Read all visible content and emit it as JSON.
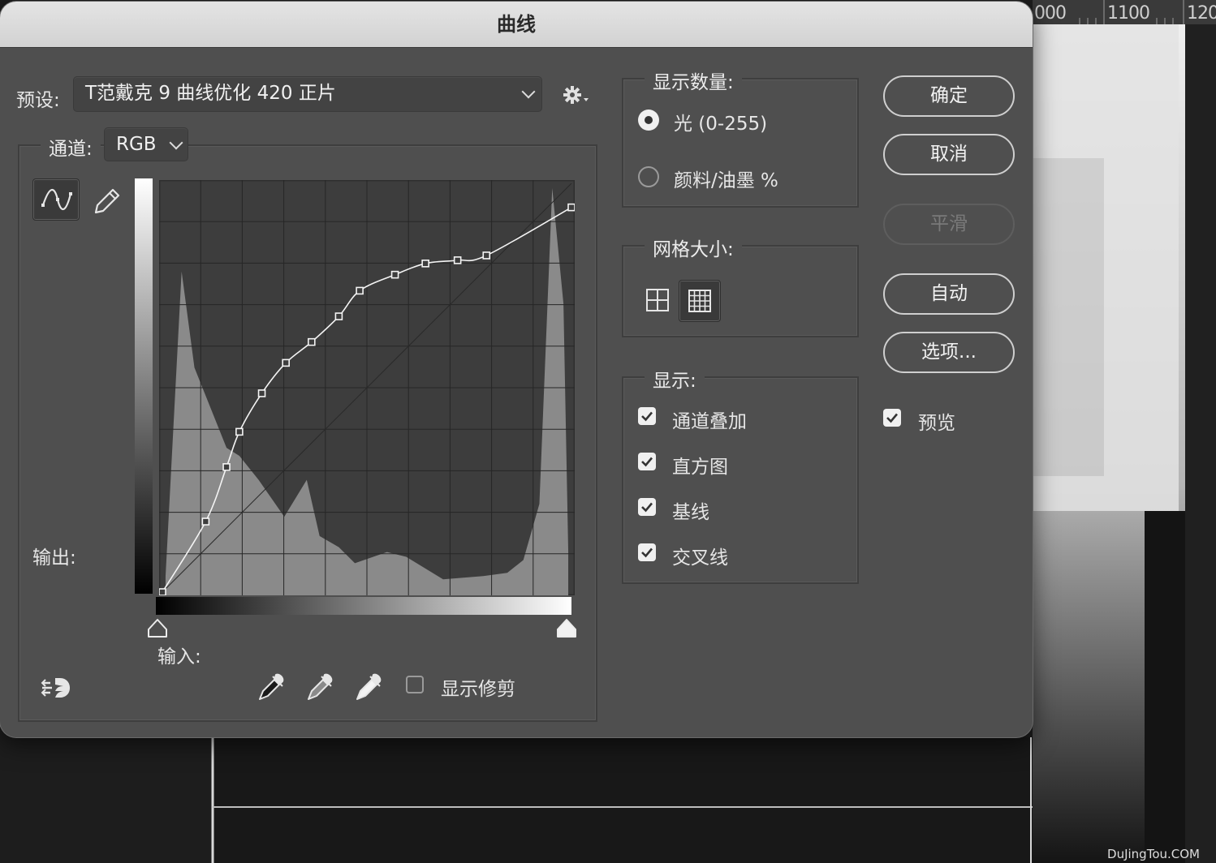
{
  "background": {
    "ruler_labels": [
      "000",
      "1100",
      "120"
    ],
    "watermark": "DuJingTou.COM"
  },
  "dialog": {
    "title": "曲线",
    "preset": {
      "label": "预设:",
      "value": "T范戴克 9 曲线优化 420 正片",
      "gear_icon": "gear-icon"
    },
    "channel": {
      "label": "通道:",
      "value": "RGB"
    },
    "tools": {
      "curve_tool_icon": "curve-point-icon",
      "pencil_tool_icon": "pencil-icon"
    },
    "output_label": "输出:",
    "input_label": "输入:",
    "eyedroppers": [
      "black-point-eyedropper-icon",
      "gray-point-eyedropper-icon",
      "white-point-eyedropper-icon"
    ],
    "show_clipping": {
      "label": "显示修剪",
      "checked": false
    },
    "show_amount": {
      "legend": "显示数量:",
      "options": [
        {
          "label": "光 (0-255)",
          "selected": true
        },
        {
          "label": "颜料/油墨 %",
          "selected": false
        }
      ]
    },
    "grid_size": {
      "legend": "网格大小:",
      "options": [
        "grid-simple-icon",
        "grid-detailed-icon"
      ],
      "selected": 1
    },
    "display": {
      "legend": "显示:",
      "items": [
        {
          "label": "通道叠加",
          "checked": true
        },
        {
          "label": "直方图",
          "checked": true
        },
        {
          "label": "基线",
          "checked": true
        },
        {
          "label": "交叉线",
          "checked": true
        }
      ]
    },
    "buttons": {
      "ok": "确定",
      "cancel": "取消",
      "smooth": "平滑",
      "auto": "自动",
      "options": "选项..."
    },
    "preview": {
      "label": "预览",
      "checked": true
    },
    "curve_points": [
      [
        0,
        0
      ],
      [
        27,
        44
      ],
      [
        40,
        78
      ],
      [
        48,
        100
      ],
      [
        62,
        124
      ],
      [
        77,
        143
      ],
      [
        93,
        156
      ],
      [
        110,
        172
      ],
      [
        123,
        188
      ],
      [
        145,
        198
      ],
      [
        164,
        205
      ],
      [
        184,
        207
      ],
      [
        202,
        210
      ],
      [
        255,
        240
      ]
    ],
    "histogram_peaks": [
      [
        2,
        10
      ],
      [
        12,
        200
      ],
      [
        20,
        140
      ],
      [
        40,
        90
      ],
      [
        48,
        85
      ],
      [
        60,
        70
      ],
      [
        76,
        47
      ],
      [
        90,
        70
      ],
      [
        98,
        35
      ],
      [
        110,
        28
      ],
      [
        120,
        18
      ],
      [
        140,
        25
      ],
      [
        152,
        22
      ],
      [
        175,
        8
      ],
      [
        200,
        10
      ],
      [
        215,
        12
      ],
      [
        225,
        20
      ],
      [
        235,
        55
      ],
      [
        243,
        252
      ],
      [
        250,
        180
      ],
      [
        253,
        25
      ]
    ]
  }
}
